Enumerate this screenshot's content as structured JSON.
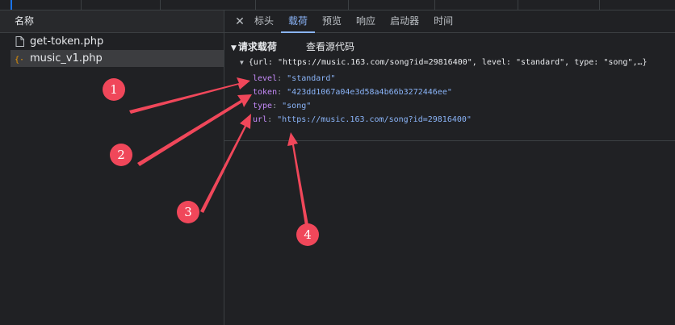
{
  "left_panel": {
    "header": "名称",
    "files": [
      {
        "name": "get-token.php",
        "icon": "document-icon",
        "selected": false
      },
      {
        "name": "music_v1.php",
        "icon": "code-braces-icon",
        "selected": true
      }
    ]
  },
  "tabs": {
    "close": "✕",
    "items": [
      "标头",
      "载荷",
      "预览",
      "响应",
      "启动器",
      "时间"
    ],
    "active": "载荷"
  },
  "payload": {
    "section_title": "请求载荷",
    "view_source": "查看源代码",
    "summary": "{url: \"https://music.163.com/song?id=29816400\", level: \"standard\", type: \"song\",…}",
    "properties": [
      {
        "key": "level",
        "value": "\"standard\""
      },
      {
        "key": "token",
        "value": "\"423dd1067a04e3d58a4b66b3272446ee\""
      },
      {
        "key": "type",
        "value": "\"song\""
      },
      {
        "key": "url",
        "value": "\"https://music.163.com/song?id=29816400\""
      }
    ]
  },
  "annotations": {
    "color": "#f0475a",
    "labels": [
      "1",
      "2",
      "3",
      "4"
    ]
  }
}
